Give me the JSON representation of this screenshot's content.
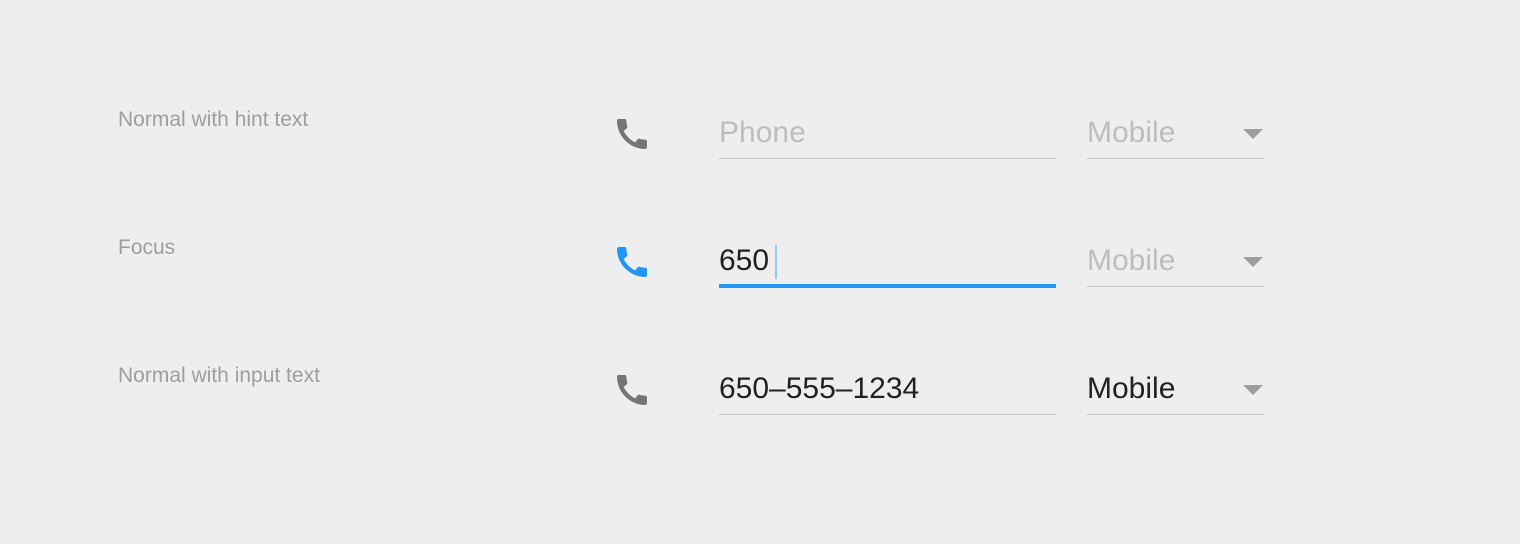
{
  "colors": {
    "background": "#eeeeee",
    "label": "#9e9e9e",
    "hint": "#bdbdbd",
    "text": "#212121",
    "icon": "#757575",
    "accent": "#2196f3",
    "divider": "#c4c4c4"
  },
  "rows": [
    {
      "label": "Normal with hint text",
      "icon": "phone-icon",
      "phone": {
        "value": "",
        "placeholder": "Phone",
        "state": "normal"
      },
      "type": {
        "value": "Mobile",
        "state": "hint"
      }
    },
    {
      "label": "Focus",
      "icon": "phone-icon",
      "phone": {
        "value": "650",
        "placeholder": "",
        "state": "focused"
      },
      "type": {
        "value": "Mobile",
        "state": "hint"
      }
    },
    {
      "label": "Normal with input text",
      "icon": "phone-icon",
      "phone": {
        "value": "650–555–1234",
        "placeholder": "",
        "state": "normal"
      },
      "type": {
        "value": "Mobile",
        "state": "filled"
      }
    }
  ]
}
